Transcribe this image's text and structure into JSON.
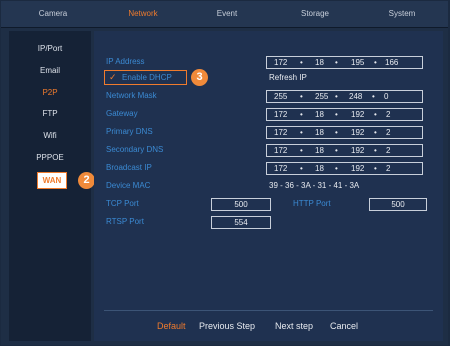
{
  "tabs": [
    {
      "label": "Camera"
    },
    {
      "label": "Network"
    },
    {
      "label": "Event"
    },
    {
      "label": "Storage"
    },
    {
      "label": "System"
    }
  ],
  "sidebar": {
    "items": [
      {
        "label": "IP/Port"
      },
      {
        "label": "Email"
      },
      {
        "label": "P2P"
      },
      {
        "label": "FTP"
      },
      {
        "label": "Wifi"
      },
      {
        "label": "PPPOE"
      },
      {
        "label": "WAN"
      }
    ]
  },
  "badges": {
    "wan": "2",
    "dhcp": "3"
  },
  "form": {
    "ip_address": {
      "label": "IP Address",
      "octets": [
        "172",
        "18",
        "195",
        "166"
      ]
    },
    "dhcp": {
      "label": "Enable DHCP",
      "checked": true
    },
    "refresh_ip": "Refresh IP",
    "network_mask": {
      "label": "Network Mask",
      "octets": [
        "255",
        "255",
        "248",
        "0"
      ]
    },
    "gateway": {
      "label": "Gateway",
      "octets": [
        "172",
        "18",
        "192",
        "2"
      ]
    },
    "primary_dns": {
      "label": "Primary DNS",
      "octets": [
        "172",
        "18",
        "192",
        "2"
      ]
    },
    "secondary_dns": {
      "label": "Secondary DNS",
      "octets": [
        "172",
        "18",
        "192",
        "2"
      ]
    },
    "broadcast_ip": {
      "label": "Broadcast IP",
      "octets": [
        "172",
        "18",
        "192",
        "2"
      ]
    },
    "device_mac": {
      "label": "Device MAC",
      "value": "39 - 36 - 3A - 31 - 41 - 3A"
    },
    "tcp_port": {
      "label": "TCP Port",
      "value": "500"
    },
    "http_port": {
      "label": "HTTP Port",
      "value": "500"
    },
    "rtsp_port": {
      "label": "RTSP Port",
      "value": "554"
    }
  },
  "footer": {
    "default": "Default",
    "previous": "Previous Step",
    "next": "Next step",
    "cancel": "Cancel"
  },
  "colors": {
    "accent": "#ef7b2d",
    "label": "#3b8ad3",
    "background": "#1e2e45"
  }
}
